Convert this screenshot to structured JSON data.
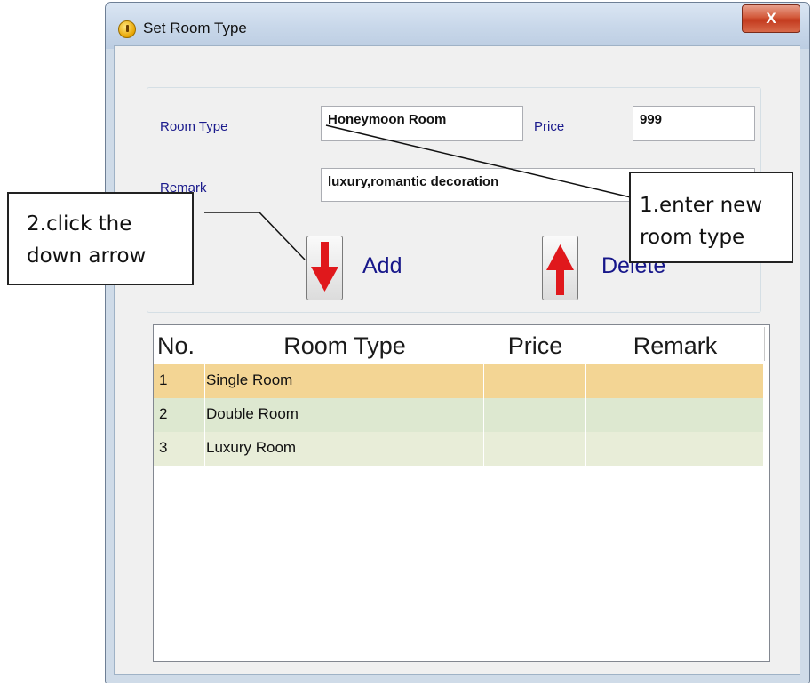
{
  "window": {
    "title": "Set Room Type",
    "close_glyph": "X"
  },
  "form": {
    "room_type_label": "Room Type",
    "room_type_value": "Honeymoon Room",
    "price_label": "Price",
    "price_value": "999",
    "remark_label": "Remark",
    "remark_value": "luxury,romantic decoration"
  },
  "buttons": {
    "add_label": "Add",
    "delete_label": "Delete"
  },
  "table": {
    "columns": [
      "No.",
      "Room Type",
      "Price",
      "Remark"
    ],
    "rows": [
      [
        "1",
        "Single Room",
        "",
        ""
      ],
      [
        "2",
        "Double Room",
        "",
        ""
      ],
      [
        "3",
        "Luxury Room",
        "",
        ""
      ]
    ]
  },
  "annotations": {
    "step1": [
      "1.enter new",
      "room type"
    ],
    "step2": [
      "2.click the",
      "down arrow"
    ]
  },
  "colors": {
    "row_selected": "#f3d594",
    "row_even": "#dde8d0",
    "row_odd": "#e8edd8",
    "arrow_red": "#e0181c"
  }
}
